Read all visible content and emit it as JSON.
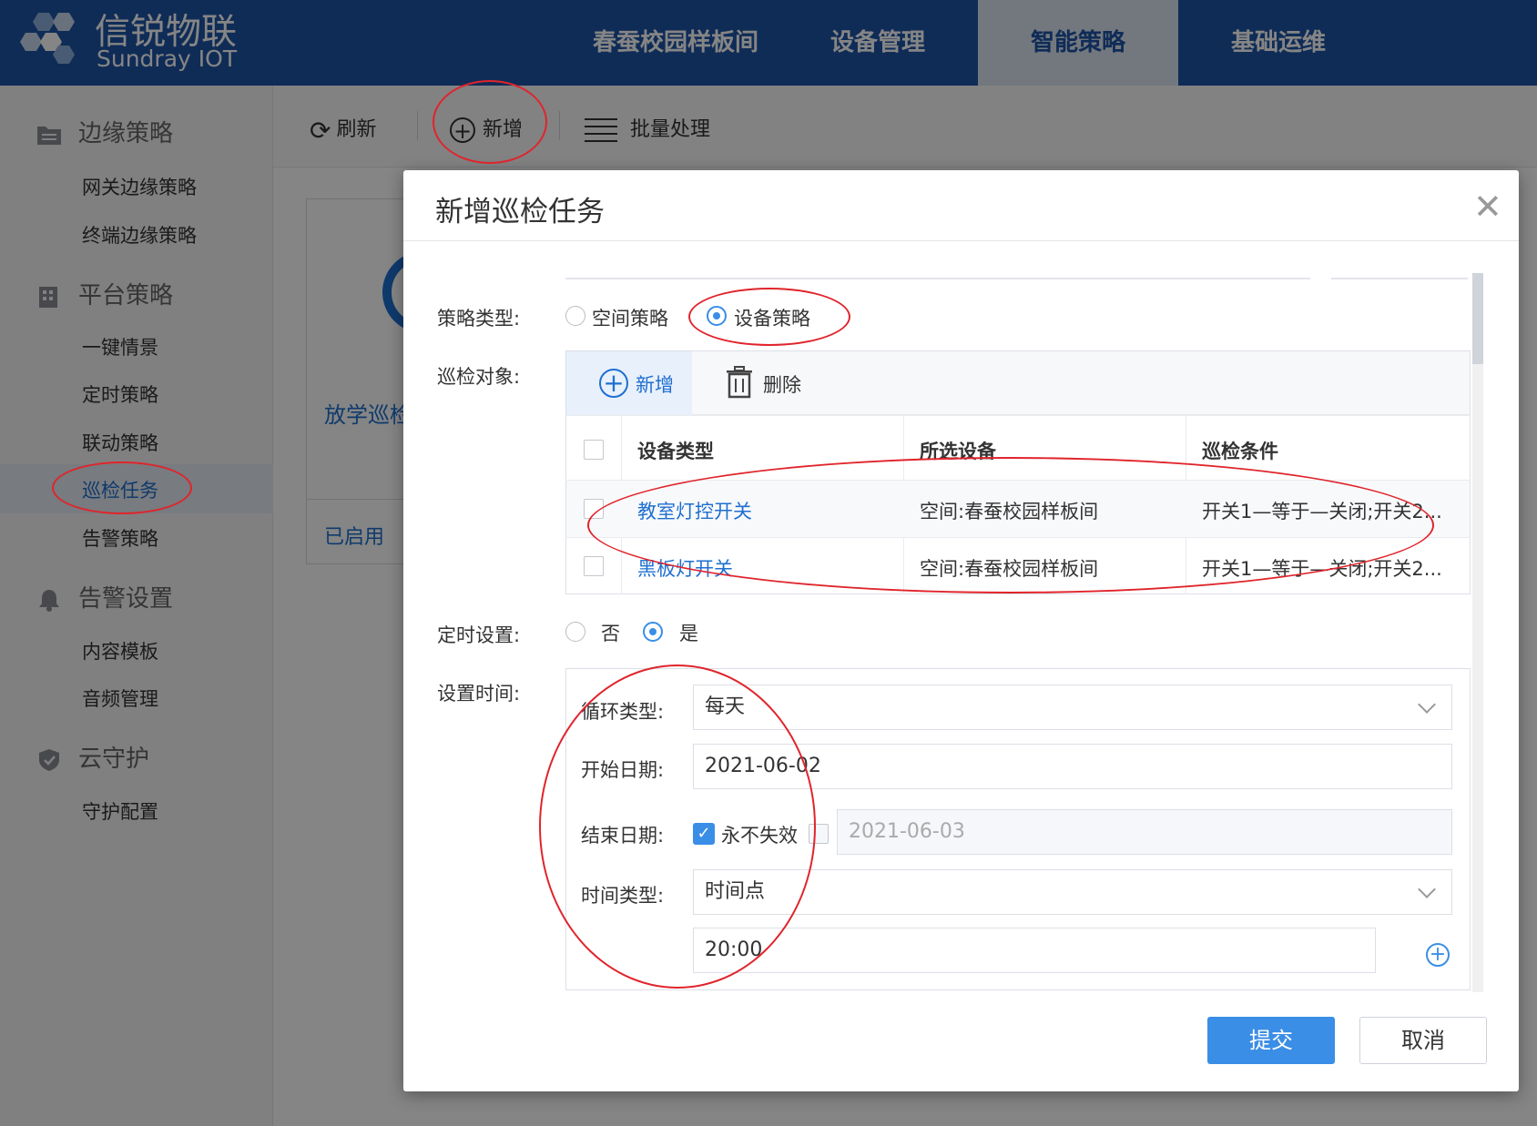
{
  "brand": {
    "name_cn": "信锐物联",
    "name_en": "Sundray IOT"
  },
  "top_nav": [
    {
      "label": "春蚕校园样板间"
    },
    {
      "label": "设备管理"
    },
    {
      "label": "智能策略",
      "active": true
    },
    {
      "label": "基础运维"
    }
  ],
  "sidebar": {
    "groups": [
      {
        "label": "边缘策略",
        "icon": "folder-icon",
        "items": [
          "网关边缘策略",
          "终端边缘策略"
        ]
      },
      {
        "label": "平台策略",
        "icon": "building-icon",
        "items": [
          "一键情景",
          "定时策略",
          "联动策略",
          "巡检任务",
          "告警策略"
        ]
      },
      {
        "label": "告警设置",
        "icon": "bell-icon",
        "items": [
          "内容模板",
          "音频管理"
        ]
      },
      {
        "label": "云守护",
        "icon": "shield-icon",
        "items": [
          "守护配置"
        ]
      }
    ],
    "active_item": "巡检任务"
  },
  "toolbar": {
    "refresh_label": "刷新",
    "add_label": "新增",
    "batch_label": "批量处理"
  },
  "background_card": {
    "title": "放学巡检",
    "status": "已启用"
  },
  "dialog": {
    "title": "新增巡检任务",
    "strategy_type": {
      "label": "策略类型:",
      "options": [
        {
          "label": "空间策略",
          "checked": false
        },
        {
          "label": "设备策略",
          "checked": true
        }
      ]
    },
    "inspection_object": {
      "label": "巡检对象:",
      "add_label": "新增",
      "delete_label": "删除",
      "columns": [
        "设备类型",
        "所选设备",
        "巡检条件"
      ],
      "rows": [
        {
          "device_type": "教室灯控开关",
          "device": "空间:春蚕校园样板间",
          "condition": "开关1—等于—关闭;开关2..."
        },
        {
          "device_type": "黑板灯开关",
          "device": "空间:春蚕校园样板间",
          "condition": "开关1—等于—关闭;开关2..."
        }
      ]
    },
    "timer_setting": {
      "label": "定时设置:",
      "options": [
        {
          "label": "否",
          "checked": false
        },
        {
          "label": "是",
          "checked": true
        }
      ]
    },
    "time_settings": {
      "label": "设置时间:",
      "cycle_type_label": "循环类型:",
      "cycle_type_value": "每天",
      "start_date_label": "开始日期:",
      "start_date_value": "2021-06-02",
      "end_date_label": "结束日期:",
      "never_expire_label": "永不失效",
      "never_expire_checked": true,
      "end_date_value": "2021-06-03",
      "time_type_label": "时间类型:",
      "time_type_value": "时间点",
      "time_point_value": "20:00"
    },
    "submit_label": "提交",
    "cancel_label": "取消"
  },
  "colors": {
    "header": "#1e55a8",
    "accent": "#3a8ee6",
    "annotation": "#e0242b"
  }
}
